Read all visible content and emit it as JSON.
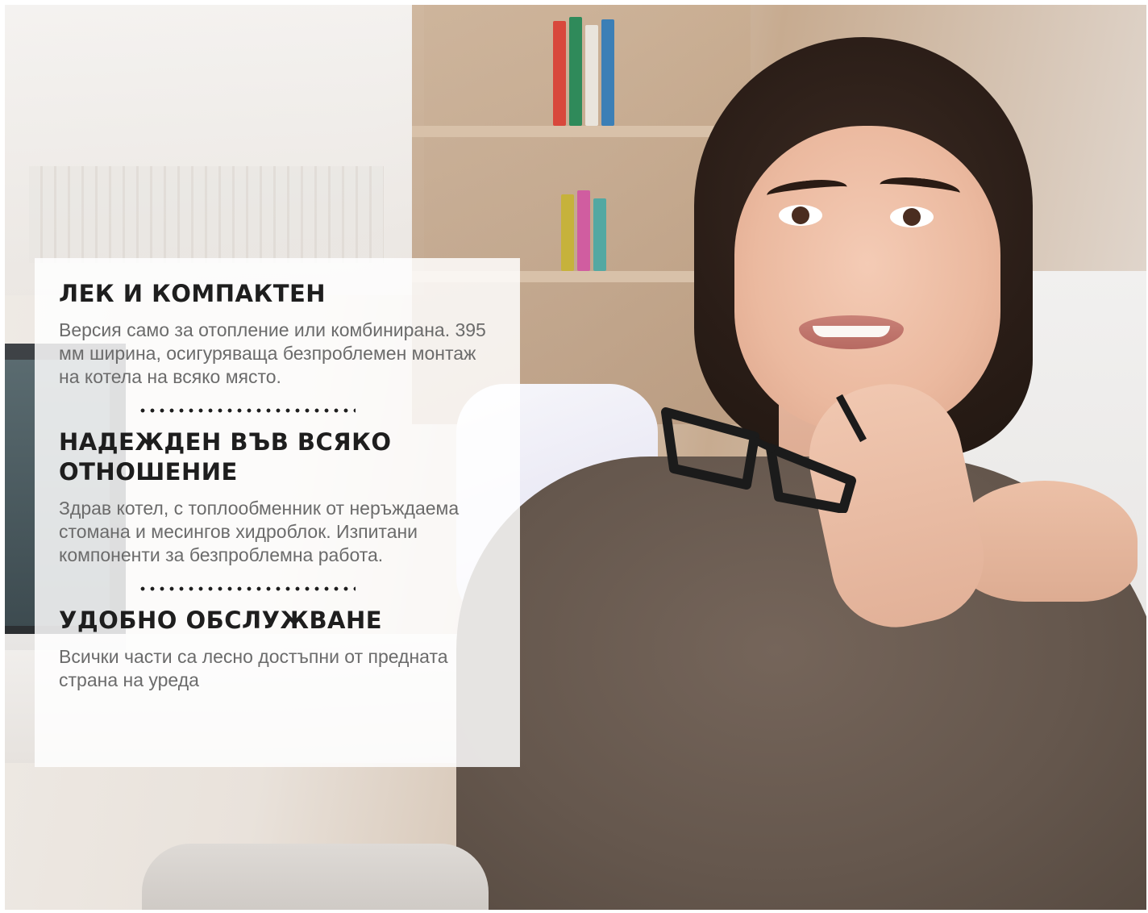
{
  "features": [
    {
      "title": "ЛЕК И КОМПАКТЕН",
      "text": "Версия само за отопление или комбинирана. 395 мм ширина, осигуряваща безпроблемен монтаж на котела на всяко място."
    },
    {
      "title": "НАДЕЖДЕН ВЪВ ВСЯКО ОТНОШЕНИЕ",
      "text": "Здрав котел, с топлообменник от неръждаема стомана и месингов хидроблок. Изпитани компоненти за безпроблемна работа."
    },
    {
      "title": "УДОБНО ОБСЛУЖВАНЕ",
      "text": "Всички части са лесно достъпни от предната страна на уреда"
    }
  ],
  "colors": {
    "panel_background": "#ffffff",
    "title_color": "#1e1e1e",
    "text_color": "#6b6b6b",
    "divider_color": "#1e1e1e"
  },
  "icons": []
}
